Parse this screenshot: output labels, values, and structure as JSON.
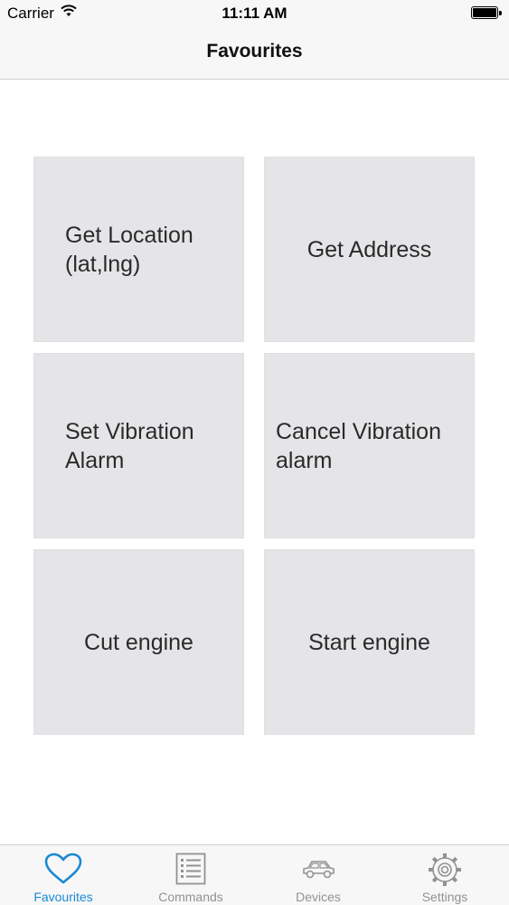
{
  "status": {
    "carrier": "Carrier",
    "time": "11:11 AM"
  },
  "nav": {
    "title": "Favourites"
  },
  "tiles": [
    {
      "label": "Get Location (lat,lng)"
    },
    {
      "label": "Get Address"
    },
    {
      "label": "Set Vibration Alarm"
    },
    {
      "label": "Cancel Vibration alarm"
    },
    {
      "label": "Cut engine"
    },
    {
      "label": "Start engine"
    }
  ],
  "tabs": [
    {
      "label": "Favourites",
      "icon": "heart-icon",
      "active": true
    },
    {
      "label": "Commands",
      "icon": "list-icon",
      "active": false
    },
    {
      "label": "Devices",
      "icon": "car-icon",
      "active": false
    },
    {
      "label": "Settings",
      "icon": "gear-icon",
      "active": false
    }
  ],
  "colors": {
    "accent": "#1a8ad4",
    "inactive": "#929292",
    "tile_bg": "#e5e5e8",
    "bar_bg": "#f7f7f7"
  }
}
